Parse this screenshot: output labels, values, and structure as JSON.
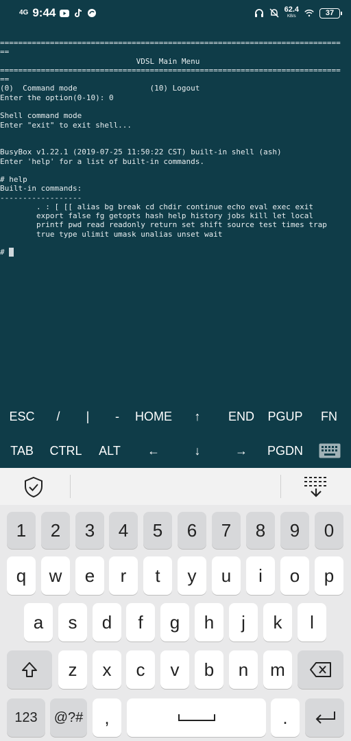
{
  "status_bar": {
    "network": "4G",
    "time": "9:44",
    "speed_value": "62.4",
    "speed_unit": "KB/s",
    "battery": "37"
  },
  "terminal": {
    "lines": [
      "===========================================================================",
      "==",
      "                              VDSL Main Menu",
      "===========================================================================",
      "==",
      "(0)  Command mode                (10) Logout",
      "Enter the option(0-10): 0",
      "",
      "Shell command mode",
      "Enter \"exit\" to exit shell...",
      "",
      "",
      "BusyBox v1.22.1 (2019-07-25 11:50:22 CST) built-in shell (ash)",
      "Enter 'help' for a list of built-in commands.",
      "",
      "# help",
      "Built-in commands:",
      "------------------",
      "        . : [ [[ alias bg break cd chdir continue echo eval exec exit",
      "        export false fg getopts hash help history jobs kill let local",
      "        printf pwd read readonly return set shift source test times trap",
      "        true type ulimit umask unalias unset wait",
      "",
      "",
      "# "
    ]
  },
  "extra_keys": {
    "row1": [
      "ESC",
      "/",
      "|",
      "-",
      "HOME",
      "↑",
      "END",
      "PGUP",
      "FN"
    ],
    "row2": [
      "TAB",
      "CTRL",
      "ALT",
      "←",
      "↓",
      "→",
      "PGDN"
    ]
  },
  "keyboard": {
    "numbers": [
      "1",
      "2",
      "3",
      "4",
      "5",
      "6",
      "7",
      "8",
      "9",
      "0"
    ],
    "row1": [
      "q",
      "w",
      "e",
      "r",
      "t",
      "y",
      "u",
      "i",
      "o",
      "p"
    ],
    "row2": [
      "a",
      "s",
      "d",
      "f",
      "g",
      "h",
      "j",
      "k",
      "l"
    ],
    "row3": [
      "z",
      "x",
      "c",
      "v",
      "b",
      "n",
      "m"
    ],
    "bottom": {
      "mode": "123",
      "symbols": "@?#",
      "comma": ",",
      "period": "."
    }
  },
  "icons": {
    "keyboard_toggle": "keyboard-icon",
    "shield": "shield-check-icon",
    "collapse": "keyboard-collapse-icon",
    "shift": "shift-icon",
    "backspace": "backspace-icon",
    "space": "space-icon",
    "enter": "enter-icon"
  },
  "colors": {
    "terminal_bg": "#0f3c48",
    "keyboard_bg": "#e9e9ea"
  }
}
